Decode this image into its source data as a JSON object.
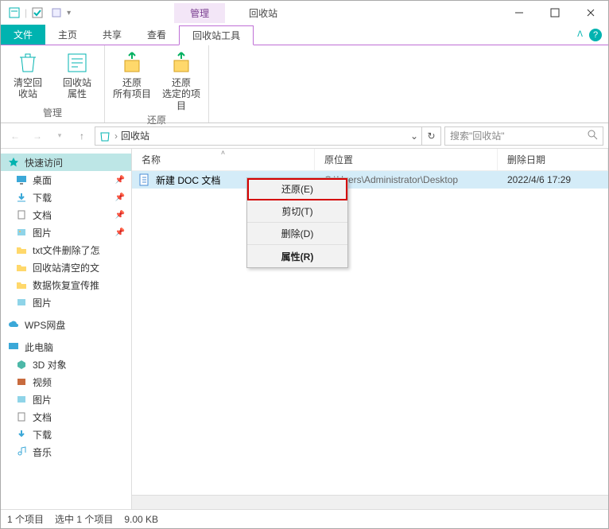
{
  "titlebar": {
    "manage_tab": "管理",
    "window_title": "回收站"
  },
  "tabs": {
    "file": "文件",
    "home": "主页",
    "share": "共享",
    "view": "查看",
    "recycle_tools": "回收站工具"
  },
  "ribbon": {
    "group1_label": "管理",
    "empty_bin": "清空回\n收站",
    "bin_props": "回收站\n属性",
    "group2_label": "还原",
    "restore_all": "还原\n所有项目",
    "restore_sel": "还原\n选定的项目"
  },
  "nav": {
    "location": "回收站",
    "search_placeholder": "搜索\"回收站\""
  },
  "columns": {
    "name": "名称",
    "location": "原位置",
    "deleted": "删除日期"
  },
  "rows": [
    {
      "name": "新建 DOC 文档",
      "location": "C:\\Users\\Administrator\\Desktop",
      "deleted": "2022/4/6 17:29"
    }
  ],
  "sidebar": {
    "quick": "快速访问",
    "desktop": "桌面",
    "downloads": "下载",
    "documents": "文档",
    "pictures": "图片",
    "f1": "txt文件删除了怎",
    "f2": "回收站清空的文",
    "f3": "数据恢复宣传推",
    "pictures2": "图片",
    "wps": "WPS网盘",
    "this_pc": "此电脑",
    "obj3d": "3D 对象",
    "videos": "视频",
    "pictures3": "图片",
    "documents2": "文档",
    "downloads2": "下载",
    "music": "音乐"
  },
  "context_menu": {
    "restore": "还原(E)",
    "cut": "剪切(T)",
    "delete": "删除(D)",
    "properties": "属性(R)"
  },
  "status": {
    "items": "1 个项目",
    "selected": "选中 1 个项目",
    "size": "9.00 KB"
  },
  "colors": {
    "accent": "#00b3b0",
    "ribbon_tab": "#bf6fd6",
    "selected_row": "#d4ecf8"
  }
}
